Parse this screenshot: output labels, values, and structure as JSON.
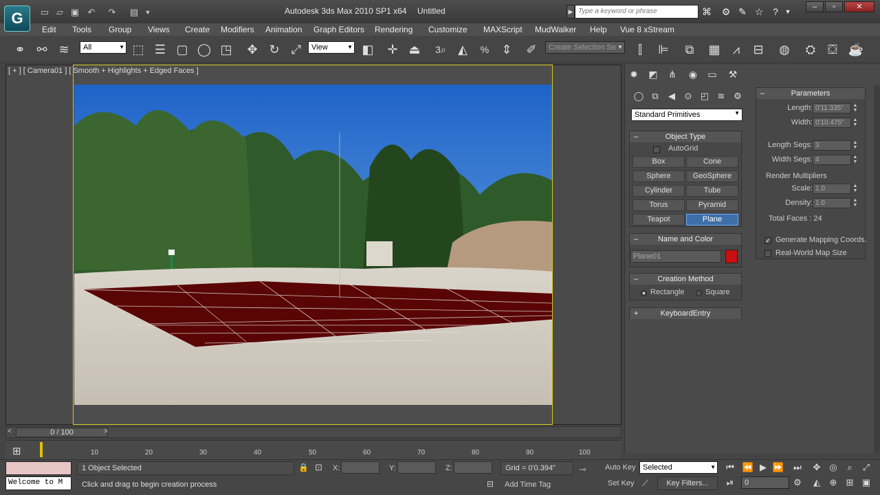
{
  "titlebar": {
    "app_title": "Autodesk 3ds Max  2010 SP1 x64",
    "document": "Untitled",
    "search_placeholder": "Type a keyword or phrase"
  },
  "menu": [
    "Edit",
    "Tools",
    "Group",
    "Views",
    "Create",
    "Modifiers",
    "Animation",
    "Graph Editors",
    "Rendering",
    "Customize",
    "MAXScript",
    "MudWalker",
    "Help",
    "Vue 8 xStream"
  ],
  "toolbar": {
    "selection_filter": "All",
    "reference_coord": "View",
    "named_selection_set": "Create Selection Se"
  },
  "viewport": {
    "label": "[ + ] [ Camera01 ] [ Smooth + Highlights + Edged Faces ]"
  },
  "command_panel": {
    "category": "Standard Primitives",
    "object_type": {
      "title": "Object Type",
      "autogrid": "AutoGrid",
      "buttons": [
        "Box",
        "Cone",
        "Sphere",
        "GeoSphere",
        "Cylinder",
        "Tube",
        "Torus",
        "Pyramid",
        "Teapot",
        "Plane"
      ],
      "active": "Plane"
    },
    "name_and_color": {
      "title": "Name and Color",
      "name": "Plane01",
      "color": "#c81010"
    },
    "creation_method": {
      "title": "Creation Method",
      "options": [
        "Rectangle",
        "Square"
      ],
      "selected": "Rectangle"
    },
    "keyboard_entry": {
      "title": "KeyboardEntry"
    },
    "parameters": {
      "title": "Parameters",
      "length_label": "Length:",
      "length": "0'11.335\"",
      "width_label": "Width:",
      "width": "0'10.475\"",
      "length_segs_label": "Length Segs:",
      "length_segs": "3",
      "width_segs_label": "Width Segs:",
      "width_segs": "4",
      "render_multipliers": "Render Multipliers",
      "scale_label": "Scale:",
      "scale": "1.0",
      "density_label": "Density:",
      "density": "1.0",
      "total_faces": "Total Faces : 24",
      "generate_mapping": "Generate Mapping Coords.",
      "real_world": "Real-World Map Size"
    }
  },
  "timeline": {
    "frame": "0 / 100",
    "ticks": [
      "10",
      "20",
      "30",
      "40",
      "50",
      "60",
      "70",
      "80",
      "90",
      "100"
    ]
  },
  "status": {
    "listener": "Welcome to M",
    "selection": "1 Object Selected",
    "prompt": "Click and drag to begin creation process",
    "x_label": "X:",
    "y_label": "Y:",
    "z_label": "Z:",
    "grid": "Grid = 0'0.394\"",
    "add_time_tag": "Add Time Tag",
    "auto_key": "Auto Key",
    "auto_key_mode": "Selected",
    "set_key": "Set Key",
    "key_filters": "Key Filters...",
    "current_frame": "0"
  }
}
